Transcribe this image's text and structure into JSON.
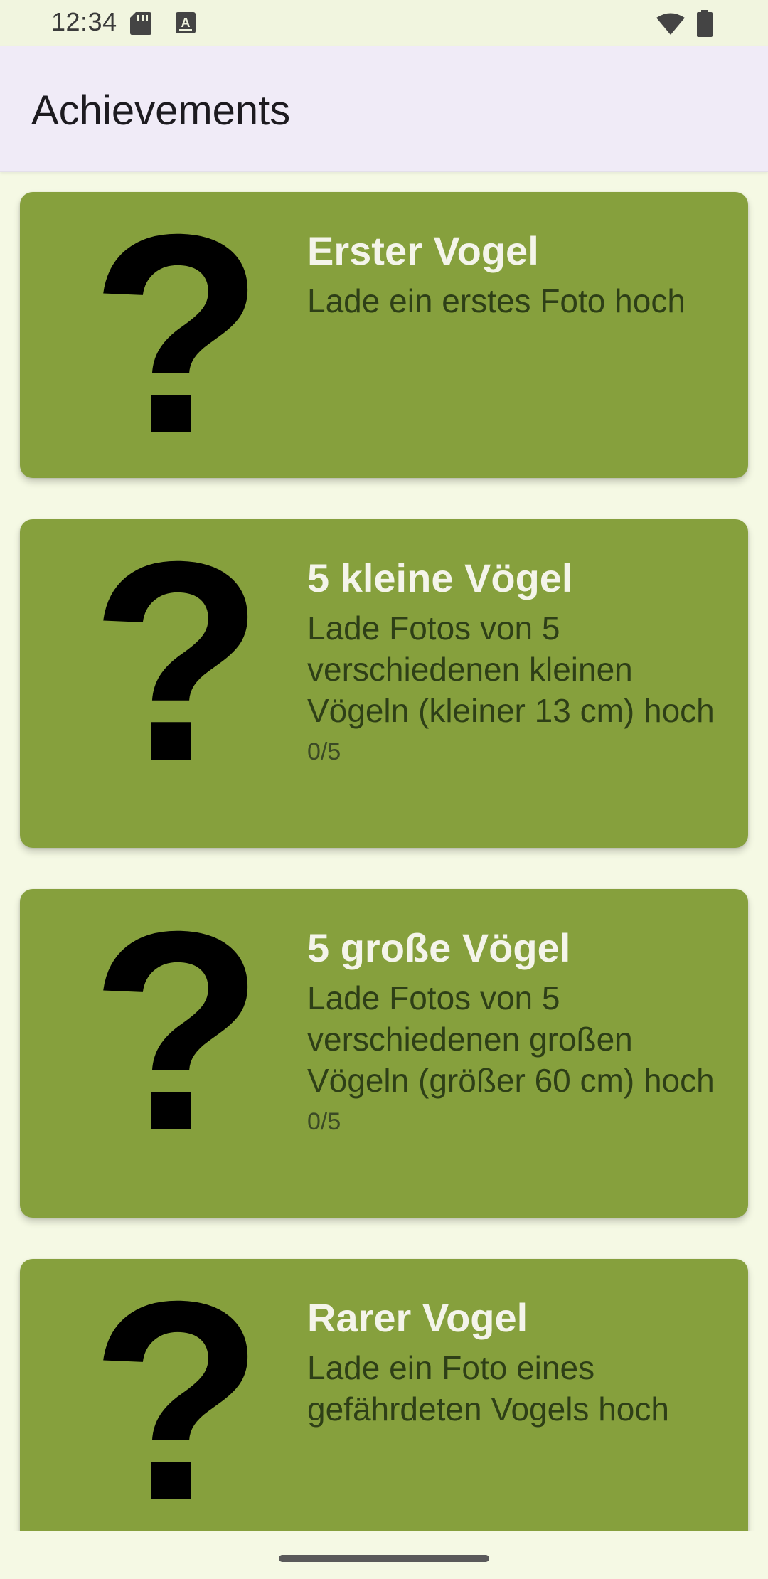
{
  "status_bar": {
    "time": "12:34",
    "icons": [
      "sd-card-icon",
      "keyboard-a-icon",
      "wifi-icon",
      "battery-icon"
    ]
  },
  "app_bar": {
    "title": "Achievements"
  },
  "achievements": [
    {
      "icon": "question-mark-icon",
      "title": "Erster Vogel",
      "description": "Lade ein erstes Foto hoch",
      "progress": ""
    },
    {
      "icon": "question-mark-icon",
      "title": "5 kleine Vögel",
      "description": "Lade Fotos von 5 verschiedenen kleinen Vögeln (kleiner 13 cm) hoch",
      "progress": "0/5"
    },
    {
      "icon": "question-mark-icon",
      "title": "5 große Vögel",
      "description": "Lade Fotos von 5 verschiedenen großen Vögeln (größer 60 cm) hoch",
      "progress": "0/5"
    },
    {
      "icon": "question-mark-icon",
      "title": "Rarer Vogel",
      "description": "Lade ein Foto eines gefährdeten Vogels hoch",
      "progress": ""
    }
  ],
  "colors": {
    "card_background": "#86a03d",
    "page_background": "#f5f9e4",
    "app_bar_background": "#f0ebf7",
    "title_text": "#f4f4ea",
    "description_text": "#2e3f17"
  }
}
